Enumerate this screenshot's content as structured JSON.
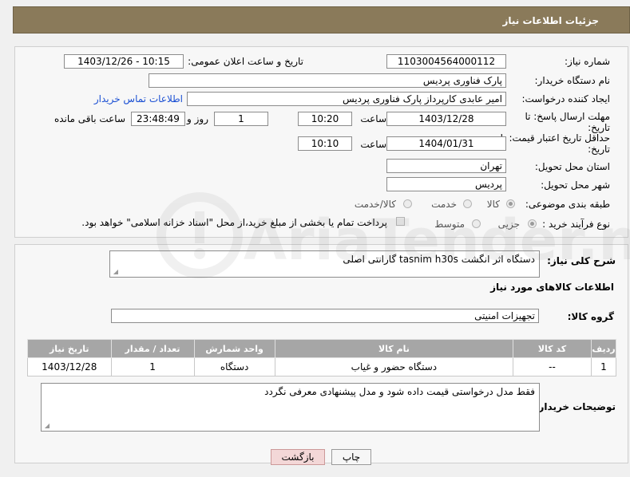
{
  "header": {
    "title": "جزئیات اطلاعات نیاز"
  },
  "form": {
    "need_number_label": "شماره نیاز:",
    "need_number": "1103004564000112",
    "announce_label": "تاریخ و ساعت اعلان عمومی:",
    "announce_value": "1403/12/26 - 10:15",
    "buyer_org_label": "نام دستگاه خریدار:",
    "buyer_org": "پارک فناوری پردیس",
    "creator_label": "ایجاد کننده درخواست:",
    "creator": "امیر عابدی کارپرداز پارک فناوری پردیس",
    "contact_link": "اطلاعات تماس خریدار",
    "deadline_label_1": "مهلت ارسال پاسخ: تا",
    "deadline_label_2": "تاریخ:",
    "deadline_date": "1403/12/28",
    "time_label": "ساعت",
    "deadline_time": "10:20",
    "days_value": "1",
    "days_label": "روز و",
    "remaining_time": "23:48:49",
    "remaining_label": "ساعت باقی مانده",
    "validity_label_1": "حداقل تاریخ اعتبار قیمت: تا",
    "validity_label_2": "تاریخ:",
    "validity_date": "1404/01/31",
    "validity_time": "10:10",
    "province_label": "استان محل تحویل:",
    "province": "تهران",
    "city_label": "شهر محل تحویل:",
    "city": "پردیس",
    "category_label": "طبقه بندی موضوعی:",
    "category_options": [
      "کالا",
      "خدمت",
      "کالا/خدمت"
    ],
    "purchase_label": "نوع فرآیند خرید :",
    "purchase_options": [
      "جزیی",
      "متوسط"
    ],
    "payment_note": "پرداخت تمام یا بخشی از مبلغ خرید،از محل \"اسناد خزانه اسلامی\" خواهد بود."
  },
  "description": {
    "label": "شرح کلی نیاز:",
    "text": "دستگاه اثر انگشت tasnim h30s گارانتی اصلی"
  },
  "goods": {
    "section_title": "اطلاعات کالاهای مورد نیاز",
    "group_label": "گروه کالا:",
    "group_value": "تجهیزات امنیتی",
    "columns": [
      "ردیف",
      "کد کالا",
      "نام کالا",
      "واحد شمارش",
      "تعداد / مقدار",
      "تاریخ نیاز"
    ],
    "rows": [
      {
        "index": "1",
        "code": "--",
        "name": "دستگاه حضور و غیاب",
        "unit": "دستگاه",
        "qty": "1",
        "date": "1403/12/28"
      }
    ]
  },
  "buyer_notes": {
    "label": "توضیحات خریدار:",
    "text": "فقط مدل درخواستی قیمت داده شود و مدل پیشنهادی معرفی نگردد"
  },
  "buttons": {
    "print": "چاپ",
    "back": "بازگشت"
  },
  "watermark": {
    "text": "AriaTender.neT"
  }
}
